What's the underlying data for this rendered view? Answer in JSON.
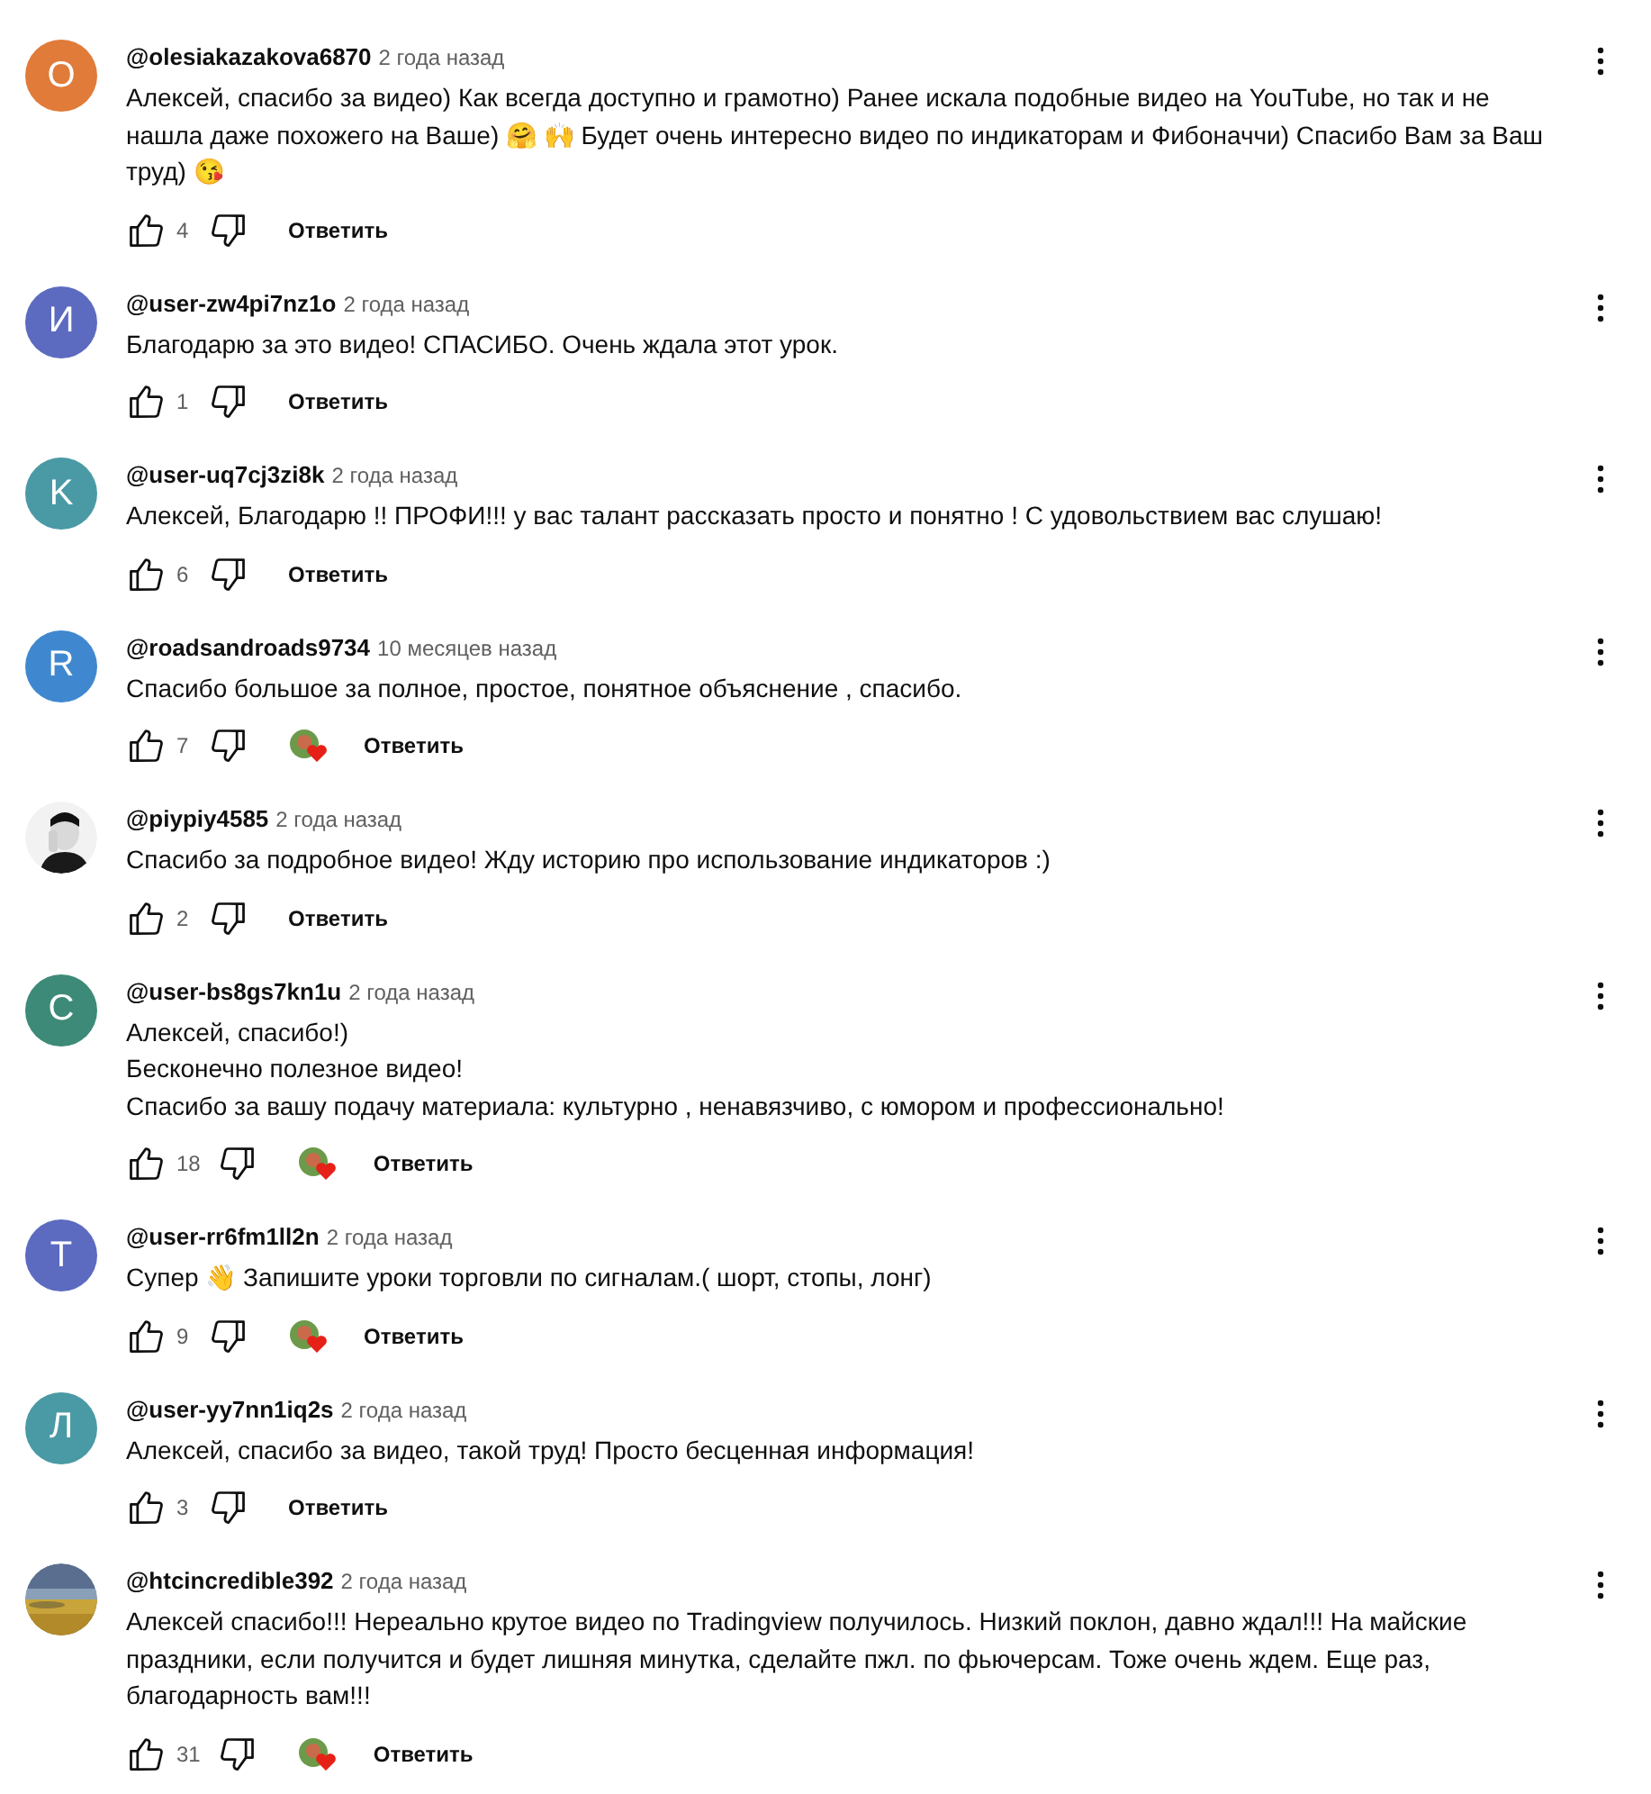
{
  "comments": [
    {
      "avatar": {
        "kind": "letter",
        "letter": "O",
        "color": "#e07b39"
      },
      "author": "@olesiakazakova6870",
      "time": "2 года назад",
      "text": "Алексей, спасибо за видео) Как всегда доступно и грамотно) Ранее искала подобные видео на YouTube, но так и не нашла даже похожего на Ваше) 🤗 🙌  Будет очень интересно видео по индикаторам и Фибоначчи) Спасибо Вам за Ваш труд) 😘",
      "likes": "4",
      "hearted": false,
      "reply": "Ответить"
    },
    {
      "avatar": {
        "kind": "letter",
        "letter": "И",
        "color": "#5c6bc0"
      },
      "author": "@user-zw4pi7nz1o",
      "time": "2 года назад",
      "text": "Благодарю за это видео! СПАСИБО. Очень ждала этот урок.",
      "likes": "1",
      "hearted": false,
      "reply": "Ответить"
    },
    {
      "avatar": {
        "kind": "letter",
        "letter": "K",
        "color": "#4a9aa5"
      },
      "author": "@user-uq7cj3zi8k",
      "time": "2 года назад",
      "text": "Алексей, Благодарю !! ПРОФИ!!! у вас талант  рассказать просто и понятно ! С удовольствием вас слушаю!",
      "likes": "6",
      "hearted": false,
      "reply": "Ответить"
    },
    {
      "avatar": {
        "kind": "letter",
        "letter": "R",
        "color": "#3f88cf"
      },
      "author": "@roadsandroads9734",
      "time": "10 месяцев назад",
      "text": "Спасибо большое за полное, простое, понятное объяснение , спасибо.",
      "likes": "7",
      "hearted": true,
      "reply": "Ответить"
    },
    {
      "author": "@piypiy4585",
      "time": "2 года назад",
      "text": "Спасибо за подробное видео! Жду историю про использование индикаторов :)",
      "likes": "2",
      "hearted": false,
      "reply": "Ответить"
    },
    {
      "avatar": {
        "kind": "letter",
        "letter": "C",
        "color": "#3d8a78"
      },
      "author": "@user-bs8gs7kn1u",
      "time": "2 года назад",
      "text": "Алексей, спасибо!)\nБесконечно полезное видео!\nСпасибо за вашу подачу материала: культурно , ненавязчиво, с юмором и профессионально!",
      "likes": "18",
      "hearted": true,
      "reply": "Ответить"
    },
    {
      "avatar": {
        "kind": "letter",
        "letter": "T",
        "color": "#5c6bc0"
      },
      "author": "@user-rr6fm1ll2n",
      "time": "2 года назад",
      "text": "Супер 👋  Запишите уроки  торговли по сигналам.( шорт, стопы, лонг)",
      "likes": "9",
      "hearted": true,
      "reply": "Ответить"
    },
    {
      "avatar": {
        "kind": "letter",
        "letter": "Л",
        "color": "#4a9aa5"
      },
      "author": "@user-yy7nn1iq2s",
      "time": "2 года назад",
      "text": "Алексей, спасибо за видео, такой труд! Просто бесценная информация!",
      "likes": "3",
      "hearted": false,
      "reply": "Ответить"
    },
    {
      "author": "@htcincredible392",
      "time": "2 года назад",
      "text": "Алексей спасибо!!! Нереально крутое видео по Tradingview получилось. Низкий поклон, давно ждал!!!  На майские праздники, если получится и будет лишняя минутка, сделайте пжл. по фьючерсам. Тоже очень ждем. Еще раз, благодарность вам!!!",
      "likes": "31",
      "hearted": true,
      "reply": "Ответить"
    }
  ]
}
